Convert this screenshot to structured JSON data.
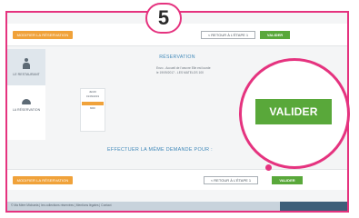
{
  "step": {
    "number": "5"
  },
  "header": {
    "modify_label": "MODIFIER LA RÉSERVATION",
    "back_label": "< RETOUR À L'ÉTAPE 1",
    "validate_label": "VALIDER"
  },
  "sidebar": {
    "items": [
      {
        "label": "LE RESTAURANT",
        "icon": "person-icon"
      },
      {
        "label": "LA RÉSERVATION",
        "icon": "dish-icon"
      }
    ]
  },
  "panel": {
    "rows": [
      "JEUDI",
      "19/09/2019",
      "MIDI"
    ]
  },
  "reservation": {
    "heading": "RÉSERVATION",
    "line1": "Enzo - Accueil de l'oeuvre Elle est lourde",
    "line2": "le 19/09/2017 - LES MATELOS 100"
  },
  "repeat": {
    "heading": "EFFECTUER LA MÊME DEMANDE POUR :"
  },
  "footer": {
    "modify_label": "MODIFIER LA RÉSERVATION",
    "back_label": "< RETOUR À L'ÉTAPE 1",
    "validate_label": "VALIDER",
    "notice": "© Ma Mère Michaela | les collections réservées | Mentions légales | Contact"
  },
  "zoom": {
    "label": "VALIDER"
  },
  "colors": {
    "accent": "#e5337f",
    "green": "#59a83a",
    "orange": "#f0a23a",
    "blue_text": "#3e87b8"
  }
}
